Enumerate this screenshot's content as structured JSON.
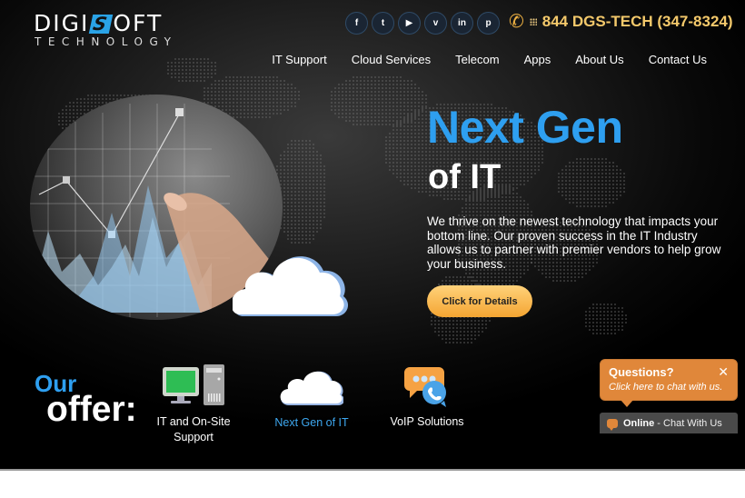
{
  "brand": {
    "logo_left": "DIGI",
    "logo_s": "S",
    "logo_right": "OFT",
    "logo_sub": "TECHNOLOGY",
    "accent_color": "#2e9ff0",
    "phone_color": "#f4c96b"
  },
  "header": {
    "social": [
      {
        "name": "facebook",
        "glyph": "f"
      },
      {
        "name": "twitter",
        "glyph": "t"
      },
      {
        "name": "youtube",
        "glyph": "▶"
      },
      {
        "name": "vimeo",
        "glyph": "v"
      },
      {
        "name": "linkedin",
        "glyph": "in"
      },
      {
        "name": "pinterest",
        "glyph": "p"
      }
    ],
    "phone": "844 DGS-TECH (347-8324)"
  },
  "nav": {
    "items": [
      "IT Support",
      "Cloud Services",
      "Telecom",
      "Apps",
      "About Us",
      "Contact Us"
    ]
  },
  "hero": {
    "title_line1": "Next Gen",
    "title_line2": "of IT",
    "description": "We thrive on the newest technology that impacts your bottom line. Our proven success in the IT Industry allows us to partner with premier vendors to help grow your business.",
    "cta_label": "Click for Details"
  },
  "offer": {
    "heading_small": "Our",
    "heading_big": "offer:",
    "services": [
      {
        "label": "IT and On-Site Support",
        "icon": "computer-icon"
      },
      {
        "label": "Next Gen of IT",
        "icon": "cloud-icon"
      },
      {
        "label": "VoIP Solutions",
        "icon": "voip-chat-icon"
      }
    ]
  },
  "chat": {
    "question": "Questions?",
    "subtitle": "Click here to chat with us.",
    "close_glyph": "✕",
    "status": "Online",
    "bar_text": " - Chat With Us"
  }
}
